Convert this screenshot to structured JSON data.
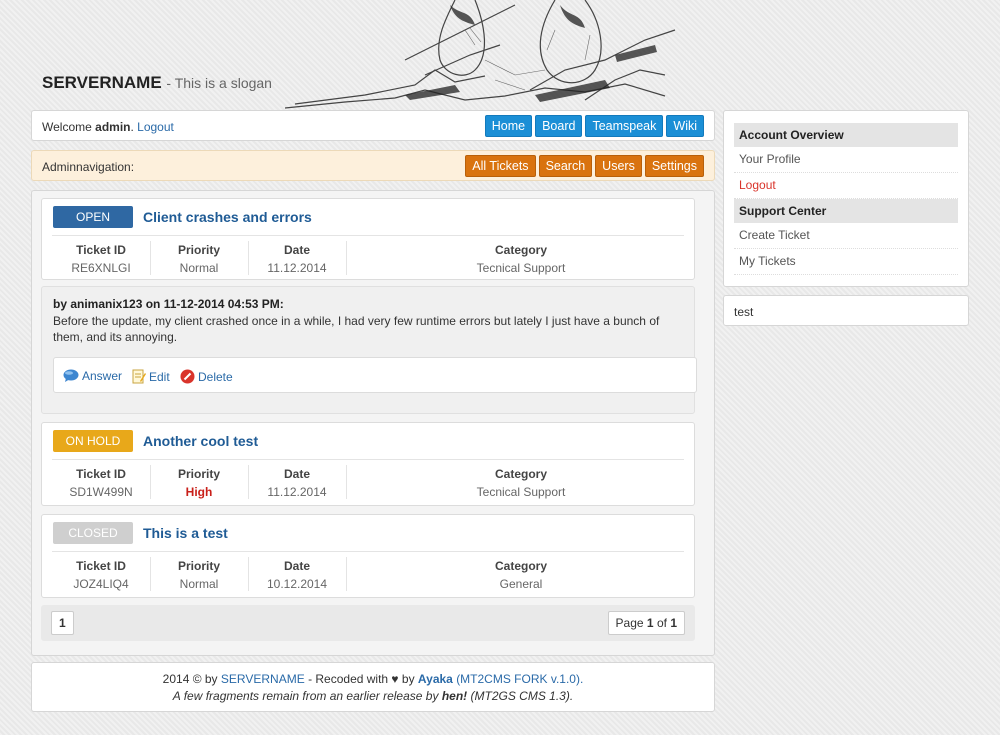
{
  "header": {
    "title": "SERVERNAME",
    "slogan": "- This is a slogan"
  },
  "welcome": {
    "prefix": "Welcome",
    "user": "admin",
    "logout": "Logout",
    "nav": [
      "Home",
      "Board",
      "Teamspeak",
      "Wiki"
    ]
  },
  "adminnav": {
    "label": "Adminnavigation:",
    "buttons": [
      "All Tickets",
      "Search",
      "Users",
      "Settings"
    ]
  },
  "columns": {
    "id": "Ticket ID",
    "priority": "Priority",
    "date": "Date",
    "category": "Category"
  },
  "tickets": [
    {
      "status": "OPEN",
      "title": "Client crashes and errors",
      "id": "RE6XNLGI",
      "priority": "Normal",
      "date": "11.12.2014",
      "category": "Tecnical Support"
    },
    {
      "status": "ON HOLD",
      "title": "Another cool test",
      "id": "SD1W499N",
      "priority": "High",
      "date": "11.12.2014",
      "category": "Tecnical Support"
    },
    {
      "status": "CLOSED",
      "title": "This is a test",
      "id": "JOZ4LIQ4",
      "priority": "Normal",
      "date": "10.12.2014",
      "category": "General"
    }
  ],
  "post": {
    "by": "by animanix123 on 11-12-2014 04:53 PM:",
    "body": "Before the update, my client crashed once in a while, I had very few runtime errors but lately I just have a bunch of them, and its annoying.",
    "actions": [
      "Answer",
      "Edit",
      "Delete"
    ]
  },
  "pager": {
    "current": "1",
    "label_page": "Page",
    "label_of": "of",
    "total": "1"
  },
  "footer": {
    "year": "2014 © by",
    "server": "SERVERNAME",
    "recoded": "- Recoded with ♥ by",
    "author": "Ayaka",
    "fork": "(MT2CMS FORK v.1.0).",
    "line2_a": "A few fragments remain from an earlier release by",
    "line2_b": "hen!",
    "line2_c": "(MT2GS CMS 1.3)."
  },
  "sidebar": {
    "account_head": "Account Overview",
    "profile": "Your Profile",
    "logout": "Logout",
    "support_head": "Support Center",
    "create": "Create Ticket",
    "mytickets": "My Tickets",
    "box2": "test"
  },
  "colors": {
    "open": "#2f68a3",
    "hold": "#e8a81a",
    "closed": "#cfcfcf",
    "nav": "#1b8fd6",
    "admin": "#d9730f",
    "high": "#c9201a",
    "logout": "#d9342b"
  }
}
